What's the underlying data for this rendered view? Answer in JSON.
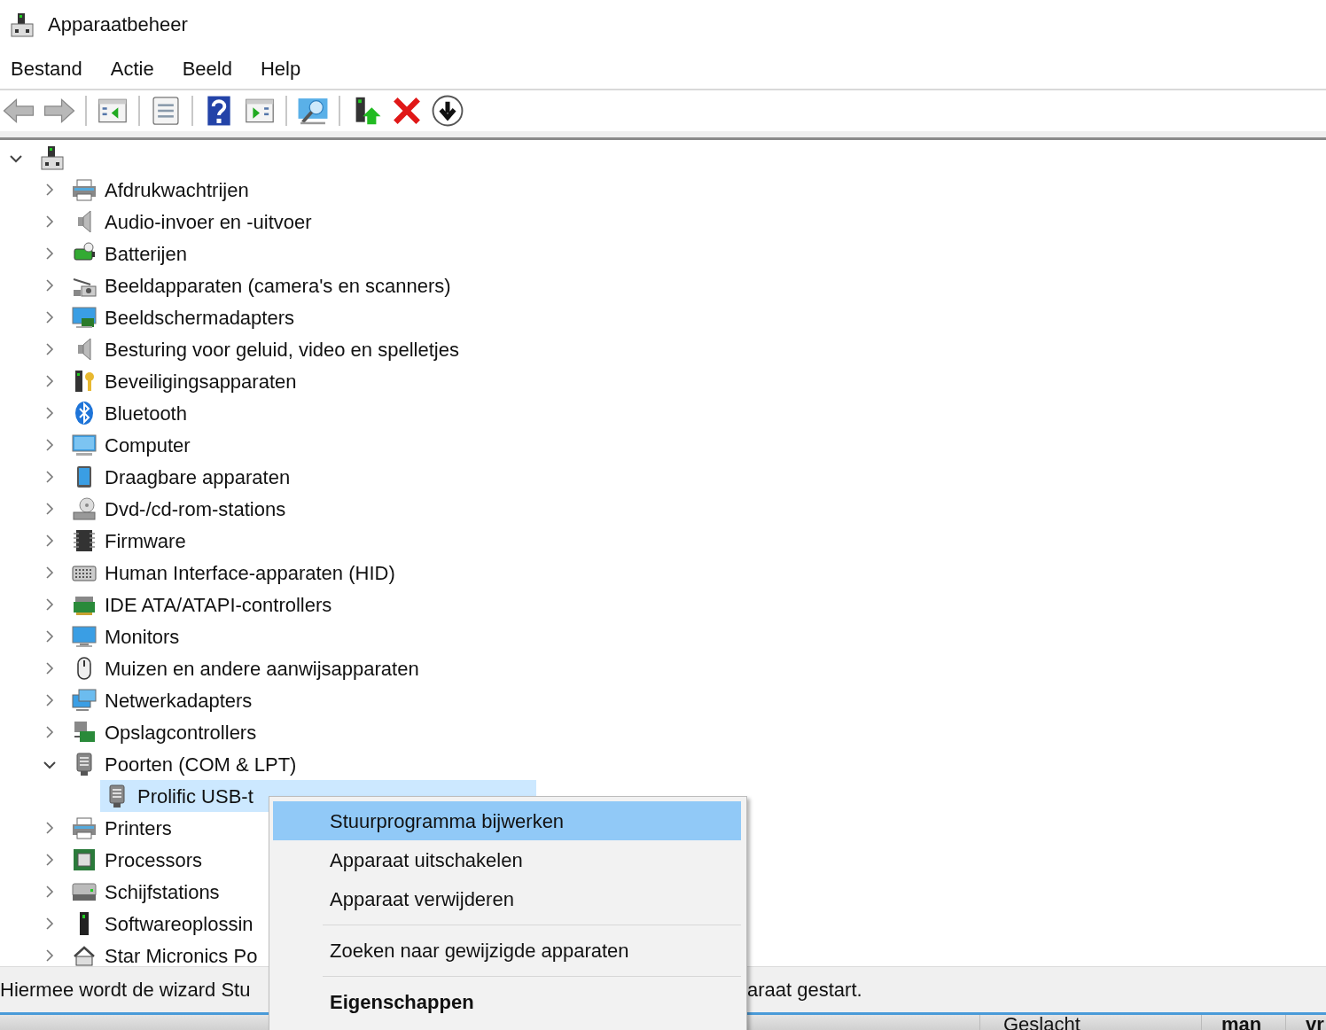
{
  "window": {
    "title": "Apparaatbeheer"
  },
  "menu": [
    "Bestand",
    "Actie",
    "Beeld",
    "Help"
  ],
  "tree": {
    "expanded": true,
    "children": [
      {
        "label": "Afdrukwachtrijen",
        "expanded": false,
        "selected": false
      },
      {
        "label": "Audio-invoer en -uitvoer",
        "expanded": false,
        "selected": false
      },
      {
        "label": "Batterijen",
        "expanded": false,
        "selected": false
      },
      {
        "label": "Beeldapparaten (camera's en scanners)",
        "expanded": false,
        "selected": false
      },
      {
        "label": "Beeldschermadapters",
        "expanded": false,
        "selected": false
      },
      {
        "label": "Besturing voor geluid, video en spelletjes",
        "expanded": false,
        "selected": false
      },
      {
        "label": "Beveiligingsapparaten",
        "expanded": false,
        "selected": false
      },
      {
        "label": "Bluetooth",
        "expanded": false,
        "selected": false
      },
      {
        "label": "Computer",
        "expanded": false,
        "selected": false
      },
      {
        "label": "Draagbare apparaten",
        "expanded": false,
        "selected": false
      },
      {
        "label": "Dvd-/cd-rom-stations",
        "expanded": false,
        "selected": false
      },
      {
        "label": "Firmware",
        "expanded": false,
        "selected": false
      },
      {
        "label": "Human Interface-apparaten (HID)",
        "expanded": false,
        "selected": false
      },
      {
        "label": "IDE ATA/ATAPI-controllers",
        "expanded": false,
        "selected": false
      },
      {
        "label": "Monitors",
        "expanded": false,
        "selected": false
      },
      {
        "label": "Muizen en andere aanwijsapparaten",
        "expanded": false,
        "selected": false
      },
      {
        "label": "Netwerkadapters",
        "expanded": false,
        "selected": false
      },
      {
        "label": "Opslagcontrollers",
        "expanded": false,
        "selected": false
      },
      {
        "label": "Poorten (COM & LPT)",
        "expanded": true,
        "selected": false,
        "children": [
          {
            "label": "Prolific USB-t",
            "selected": true
          }
        ]
      },
      {
        "label": "Printers",
        "expanded": false,
        "selected": false
      },
      {
        "label": "Processors",
        "expanded": false,
        "selected": false
      },
      {
        "label": "Schijfstations",
        "expanded": false,
        "selected": false
      },
      {
        "label": "Softwareoplossin",
        "expanded": false,
        "selected": false
      },
      {
        "label": "Star Micronics Po",
        "expanded": false,
        "selected": false
      }
    ]
  },
  "context_menu": [
    {
      "kind": "item",
      "label": "Stuurprogramma bijwerken",
      "selected": true,
      "default": false
    },
    {
      "kind": "item",
      "label": "Apparaat uitschakelen",
      "selected": false,
      "default": false
    },
    {
      "kind": "item",
      "label": "Apparaat verwijderen",
      "selected": false,
      "default": false
    },
    {
      "kind": "separator"
    },
    {
      "kind": "item",
      "label": "Zoeken naar gewijzigde apparaten",
      "selected": false,
      "default": false
    },
    {
      "kind": "separator"
    },
    {
      "kind": "item",
      "label": "Eigenschappen",
      "selected": false,
      "default": true
    }
  ],
  "status_bar": [
    "Hiermee wordt de wizard Stu",
    "araat gestart."
  ],
  "background_window": {
    "cells": [
      "Geslacht",
      "man",
      "vr"
    ]
  }
}
